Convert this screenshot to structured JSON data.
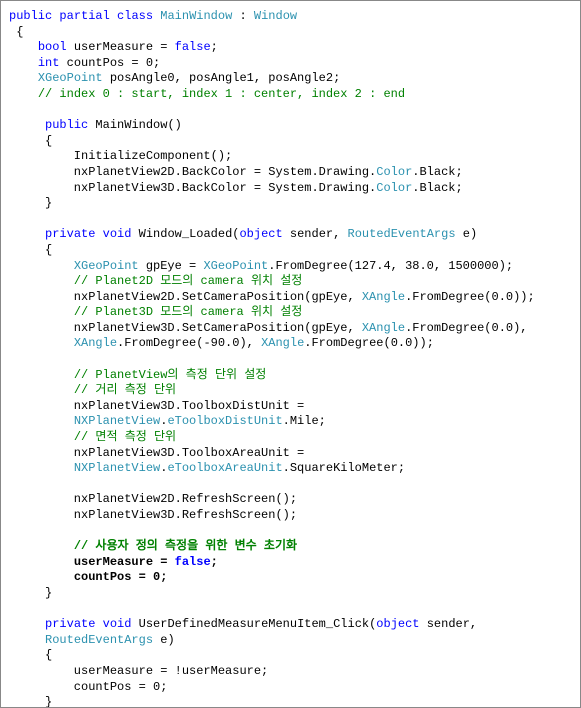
{
  "code": {
    "tokens": [
      {
        "t": "public",
        "c": "kw"
      },
      {
        "t": " "
      },
      {
        "t": "partial",
        "c": "kw"
      },
      {
        "t": " "
      },
      {
        "t": "class",
        "c": "kw"
      },
      {
        "t": " "
      },
      {
        "t": "MainWindow",
        "c": "type"
      },
      {
        "t": " : "
      },
      {
        "t": "Window",
        "c": "type"
      },
      {
        "t": "\n"
      },
      {
        "t": " {"
      },
      {
        "t": "\n"
      },
      {
        "t": "    "
      },
      {
        "t": "bool",
        "c": "kw"
      },
      {
        "t": " userMeasure = "
      },
      {
        "t": "false",
        "c": "kw"
      },
      {
        "t": ";"
      },
      {
        "t": "\n"
      },
      {
        "t": "    "
      },
      {
        "t": "int",
        "c": "kw"
      },
      {
        "t": " countPos = 0;"
      },
      {
        "t": "\n"
      },
      {
        "t": "    "
      },
      {
        "t": "XGeoPoint",
        "c": "type"
      },
      {
        "t": " posAngle0, posAngle1, posAngle2;"
      },
      {
        "t": "\n"
      },
      {
        "t": "    "
      },
      {
        "t": "// index 0 : start, index 1 : center, index 2 : end",
        "c": "comment"
      },
      {
        "t": "\n"
      },
      {
        "t": "\n"
      },
      {
        "t": "     "
      },
      {
        "t": "public",
        "c": "kw"
      },
      {
        "t": " MainWindow()"
      },
      {
        "t": "\n"
      },
      {
        "t": "     {"
      },
      {
        "t": "\n"
      },
      {
        "t": "         InitializeComponent();"
      },
      {
        "t": "\n"
      },
      {
        "t": "         nxPlanetView2D.BackColor = System.Drawing."
      },
      {
        "t": "Color",
        "c": "type"
      },
      {
        "t": ".Black;"
      },
      {
        "t": "\n"
      },
      {
        "t": "         nxPlanetView3D.BackColor = System.Drawing."
      },
      {
        "t": "Color",
        "c": "type"
      },
      {
        "t": ".Black;"
      },
      {
        "t": "\n"
      },
      {
        "t": "     }"
      },
      {
        "t": "\n"
      },
      {
        "t": "\n"
      },
      {
        "t": "     "
      },
      {
        "t": "private",
        "c": "kw"
      },
      {
        "t": " "
      },
      {
        "t": "void",
        "c": "kw"
      },
      {
        "t": " Window_Loaded("
      },
      {
        "t": "object",
        "c": "kw"
      },
      {
        "t": " sender, "
      },
      {
        "t": "RoutedEventArgs",
        "c": "type"
      },
      {
        "t": " e)"
      },
      {
        "t": "\n"
      },
      {
        "t": "     {"
      },
      {
        "t": "\n"
      },
      {
        "t": "         "
      },
      {
        "t": "XGeoPoint",
        "c": "type"
      },
      {
        "t": " gpEye = "
      },
      {
        "t": "XGeoPoint",
        "c": "type"
      },
      {
        "t": ".FromDegree(127.4, 38.0, 1500000);"
      },
      {
        "t": "\n"
      },
      {
        "t": "         "
      },
      {
        "t": "// Planet2D 모드의 camera 위치 설정",
        "c": "comment"
      },
      {
        "t": "\n"
      },
      {
        "t": "         nxPlanetView2D.SetCameraPosition(gpEye, "
      },
      {
        "t": "XAngle",
        "c": "type"
      },
      {
        "t": ".FromDegree(0.0));"
      },
      {
        "t": "\n"
      },
      {
        "t": "         "
      },
      {
        "t": "// Planet3D 모드의 camera 위치 설정",
        "c": "comment"
      },
      {
        "t": "\n"
      },
      {
        "t": "         nxPlanetView3D.SetCameraPosition(gpEye, "
      },
      {
        "t": "XAngle",
        "c": "type"
      },
      {
        "t": ".FromDegree(0.0),"
      },
      {
        "t": "\n"
      },
      {
        "t": "         "
      },
      {
        "t": "XAngle",
        "c": "type"
      },
      {
        "t": ".FromDegree(-90.0), "
      },
      {
        "t": "XAngle",
        "c": "type"
      },
      {
        "t": ".FromDegree(0.0));"
      },
      {
        "t": "\n"
      },
      {
        "t": "\n"
      },
      {
        "t": "         "
      },
      {
        "t": "// PlanetView의 측정 단위 설정",
        "c": "comment"
      },
      {
        "t": "\n"
      },
      {
        "t": "         "
      },
      {
        "t": "// 거리 측정 단위",
        "c": "comment"
      },
      {
        "t": "\n"
      },
      {
        "t": "         nxPlanetView3D.ToolboxDistUnit ="
      },
      {
        "t": "\n"
      },
      {
        "t": "         "
      },
      {
        "t": "NXPlanetView",
        "c": "type"
      },
      {
        "t": "."
      },
      {
        "t": "eToolboxDistUnit",
        "c": "enum-type"
      },
      {
        "t": ".Mile;"
      },
      {
        "t": "\n"
      },
      {
        "t": "         "
      },
      {
        "t": "// 면적 측정 단위",
        "c": "comment"
      },
      {
        "t": "\n"
      },
      {
        "t": "         nxPlanetView3D.ToolboxAreaUnit ="
      },
      {
        "t": "\n"
      },
      {
        "t": "         "
      },
      {
        "t": "NXPlanetView",
        "c": "type"
      },
      {
        "t": "."
      },
      {
        "t": "eToolboxAreaUnit",
        "c": "enum-type"
      },
      {
        "t": ".SquareKiloMeter;"
      },
      {
        "t": "\n"
      },
      {
        "t": "\n"
      },
      {
        "t": "         nxPlanetView2D.RefreshScreen();"
      },
      {
        "t": "\n"
      },
      {
        "t": "         nxPlanetView3D.RefreshScreen();"
      },
      {
        "t": "\n"
      },
      {
        "t": "\n"
      },
      {
        "t": "         "
      },
      {
        "t": "// 사용자 정의 측정을 위한 변수 초기화",
        "c": "comment highlight"
      },
      {
        "t": "\n"
      },
      {
        "t": "         "
      },
      {
        "t": "userMeasure = ",
        "c": "highlight"
      },
      {
        "t": "false",
        "c": "kw highlight"
      },
      {
        "t": ";",
        "c": "highlight"
      },
      {
        "t": "\n"
      },
      {
        "t": "         "
      },
      {
        "t": "countPos = 0;",
        "c": "highlight"
      },
      {
        "t": "\n"
      },
      {
        "t": "     }"
      },
      {
        "t": "\n"
      },
      {
        "t": "\n"
      },
      {
        "t": "     "
      },
      {
        "t": "private",
        "c": "kw"
      },
      {
        "t": " "
      },
      {
        "t": "void",
        "c": "kw"
      },
      {
        "t": " UserDefinedMeasureMenuItem_Click("
      },
      {
        "t": "object",
        "c": "kw"
      },
      {
        "t": " sender,"
      },
      {
        "t": "\n"
      },
      {
        "t": "     "
      },
      {
        "t": "RoutedEventArgs",
        "c": "type"
      },
      {
        "t": " e)"
      },
      {
        "t": "\n"
      },
      {
        "t": "     {"
      },
      {
        "t": "\n"
      },
      {
        "t": "         userMeasure = !userMeasure;"
      },
      {
        "t": "\n"
      },
      {
        "t": "         countPos = 0;"
      },
      {
        "t": "\n"
      },
      {
        "t": "     }"
      },
      {
        "t": "\n"
      }
    ]
  }
}
